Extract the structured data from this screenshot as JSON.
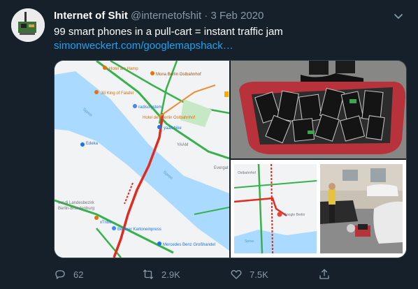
{
  "tweet": {
    "display_name": "Internet of Shit",
    "handle": "@internetofshit",
    "separator": "·",
    "date": "3 Feb 2020",
    "text_before": "99 smart phones in a pull-cart = instant traffic jam ",
    "link_text": "simonweckert.com/googlemapshack…"
  },
  "map_left": {
    "labels": [
      "Hotel am Hamp",
      "Mona Berlin Ostbahnhof",
      "Jill King of Falafel",
      "radisolystem",
      "Hotel des Berlin Ostbahnhof",
      "Spree",
      "yaambike",
      "YAAM",
      "Spree",
      "Evergat",
      "Landesbezirk Berlin-Brandenburg",
      "ver.di",
      "xTribo",
      "Berliner Kartoneinpress",
      "Mercedes Benz Großhandel",
      "Edeka"
    ]
  },
  "map_right": {
    "labels": [
      "Google Berlin",
      "Spree",
      "Ostbahnhof"
    ]
  },
  "actions": {
    "reply_count": "62",
    "retweet_count": "2.9K",
    "like_count": "7.5K"
  },
  "colors": {
    "background": "#15202b",
    "link": "#1da1f2",
    "muted": "#8899a6"
  }
}
